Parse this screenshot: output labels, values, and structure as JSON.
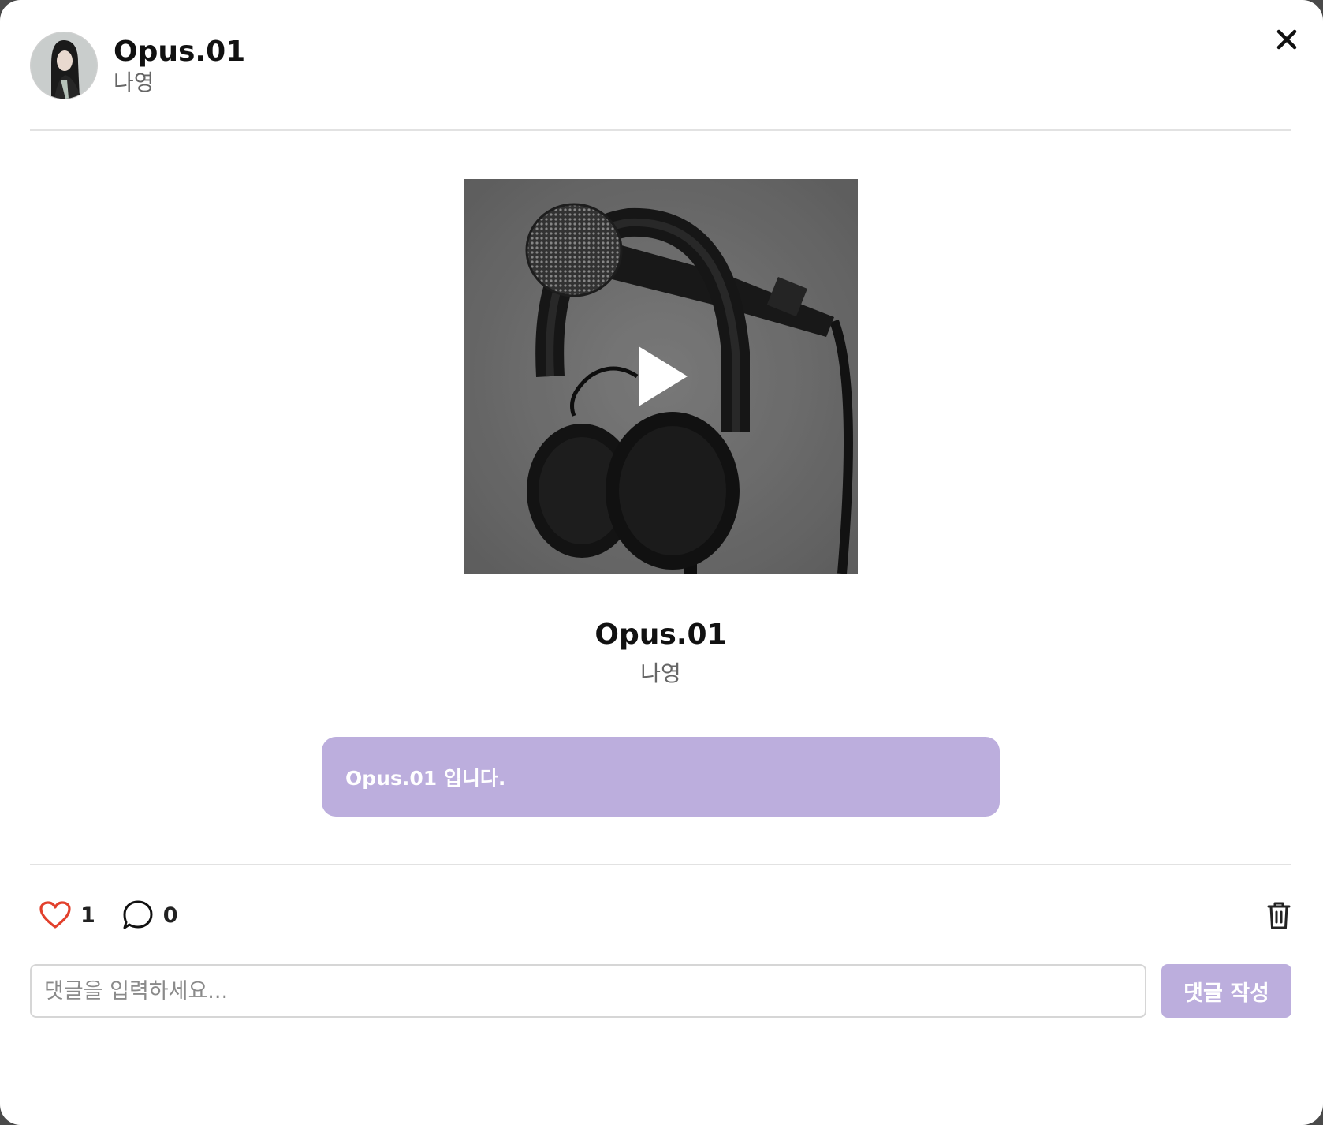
{
  "header": {
    "title": "Opus.01",
    "artist": "나영",
    "avatar_icon": "profile-photo",
    "close_icon": "close-icon"
  },
  "media": {
    "cover_icon": "microphone-and-headphones-photo",
    "play_icon": "play-icon"
  },
  "track": {
    "title": "Opus.01",
    "artist": "나영"
  },
  "description": {
    "text": "Opus.01 입니다."
  },
  "stats": {
    "likes": "1",
    "comments": "0"
  },
  "comment": {
    "placeholder": "댓글을 입력하세요...",
    "value": "",
    "submit_label": "댓글 작성"
  },
  "colors": {
    "accent": "#bcaedd",
    "heart": "#e2402c",
    "divider": "#e2e2e2",
    "title_text": "#111111",
    "sub_text": "#666666"
  }
}
